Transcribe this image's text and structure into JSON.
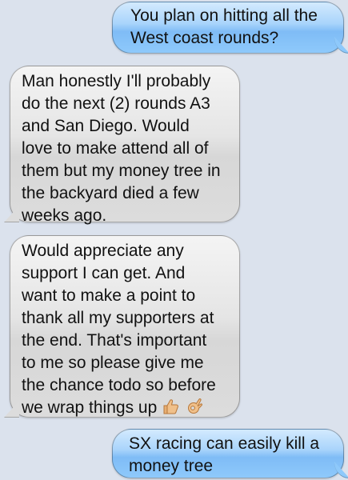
{
  "messages": [
    {
      "direction": "sent",
      "text": "You plan on hitting all the\nWest coast rounds?"
    },
    {
      "direction": "received",
      "text": "Man honestly I'll probably\ndo the next (2) rounds A3\nand San Diego. Would\nlove to make attend all of\nthem but my money tree in\nthe backyard died a few\nweeks ago."
    },
    {
      "direction": "received",
      "text": "Would appreciate any\nsupport I can get. And\nwant to make a point to\nthank all my supporters at\nthe end. That's important\nto me so please give me\nthe chance todo so before\nwe wrap things up",
      "emojis": [
        "thumbs-up-icon",
        "ok-hand-icon"
      ]
    },
    {
      "direction": "sent",
      "text": "SX racing can easily kill a\nmoney tree"
    }
  ],
  "colors": {
    "background": "#dbe2ed",
    "sent_bubble": "#8ec9fb",
    "received_bubble": "#dcdcdc",
    "emoji_skin": "#f0c08a"
  }
}
